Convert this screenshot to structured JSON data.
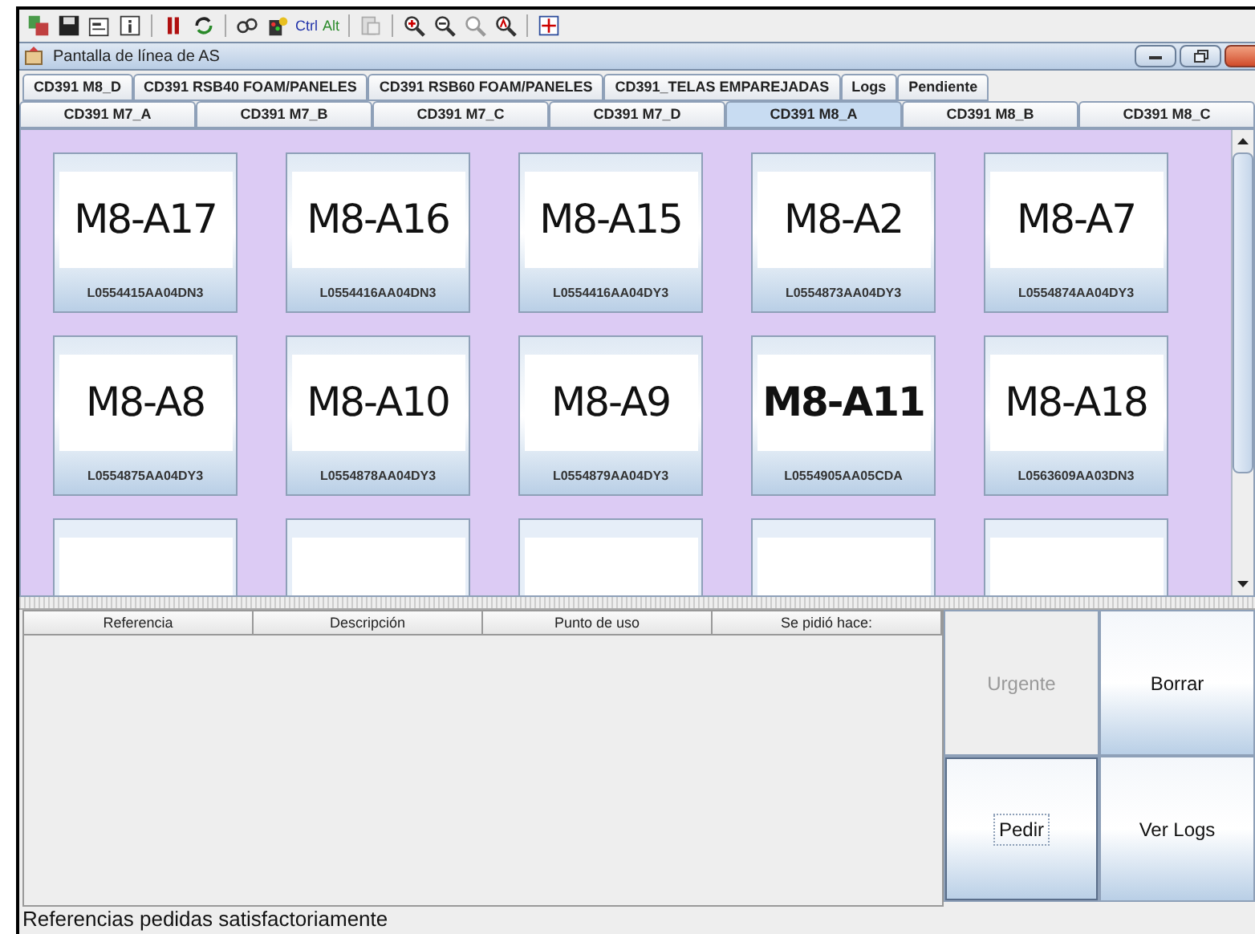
{
  "toolbar": {
    "texts": [
      "Ctrl",
      "Alt"
    ]
  },
  "window": {
    "title": "Pantalla de línea de AS"
  },
  "tabs_row_1": [
    {
      "label": "CD391 M8_D",
      "selected": false
    },
    {
      "label": "CD391 RSB40 FOAM/PANELES",
      "selected": false
    },
    {
      "label": "CD391 RSB60 FOAM/PANELES",
      "selected": false
    },
    {
      "label": "CD391_TELAS EMPAREJADAS",
      "selected": false
    },
    {
      "label": "Logs",
      "selected": false
    },
    {
      "label": "Pendiente",
      "selected": false
    }
  ],
  "tabs_row_2": [
    {
      "label": "CD391 M7_A",
      "selected": false
    },
    {
      "label": "CD391 M7_B",
      "selected": false
    },
    {
      "label": "CD391 M7_C",
      "selected": false
    },
    {
      "label": "CD391 M7_D",
      "selected": false
    },
    {
      "label": "CD391 M8_A",
      "selected": true
    },
    {
      "label": "CD391 M8_B",
      "selected": false
    },
    {
      "label": "CD391 M8_C",
      "selected": false
    }
  ],
  "cards": [
    {
      "kind": "full",
      "label": "M8-A17",
      "code": "L0554415AA04DN3",
      "bold": false
    },
    {
      "kind": "full",
      "label": "M8-A16",
      "code": "L0554416AA04DN3",
      "bold": false
    },
    {
      "kind": "full",
      "label": "M8-A15",
      "code": "L0554416AA04DY3",
      "bold": false
    },
    {
      "kind": "full",
      "label": "M8-A2",
      "code": "L0554873AA04DY3",
      "bold": false
    },
    {
      "kind": "full",
      "label": "M8-A7",
      "code": "L0554874AA04DY3",
      "bold": false
    },
    {
      "kind": "full",
      "label": "M8-A8",
      "code": "L0554875AA04DY3",
      "bold": false
    },
    {
      "kind": "full",
      "label": "M8-A10",
      "code": "L0554878AA04DY3",
      "bold": false
    },
    {
      "kind": "full",
      "label": "M8-A9",
      "code": "L0554879AA04DY3",
      "bold": false
    },
    {
      "kind": "full",
      "label": "M8-A11",
      "code": "L0554905AA05CDA",
      "bold": true
    },
    {
      "kind": "full",
      "label": "M8-A18",
      "code": "L0563609AA03DN3",
      "bold": false
    },
    {
      "kind": "cut"
    },
    {
      "kind": "cut"
    },
    {
      "kind": "cut"
    },
    {
      "kind": "cut"
    },
    {
      "kind": "cut"
    }
  ],
  "table": {
    "columns": [
      "Referencia",
      "Descripción",
      "Punto de uso",
      "Se pidió hace:"
    ]
  },
  "buttons": [
    {
      "label": "Urgente",
      "disabled": true,
      "focused": false
    },
    {
      "label": "Borrar",
      "disabled": false,
      "focused": false
    },
    {
      "label": "Pedir",
      "disabled": false,
      "focused": true
    },
    {
      "label": "Ver Logs",
      "disabled": false,
      "focused": false
    }
  ],
  "status_bar": "Referencias pedidas satisfactoriamente"
}
